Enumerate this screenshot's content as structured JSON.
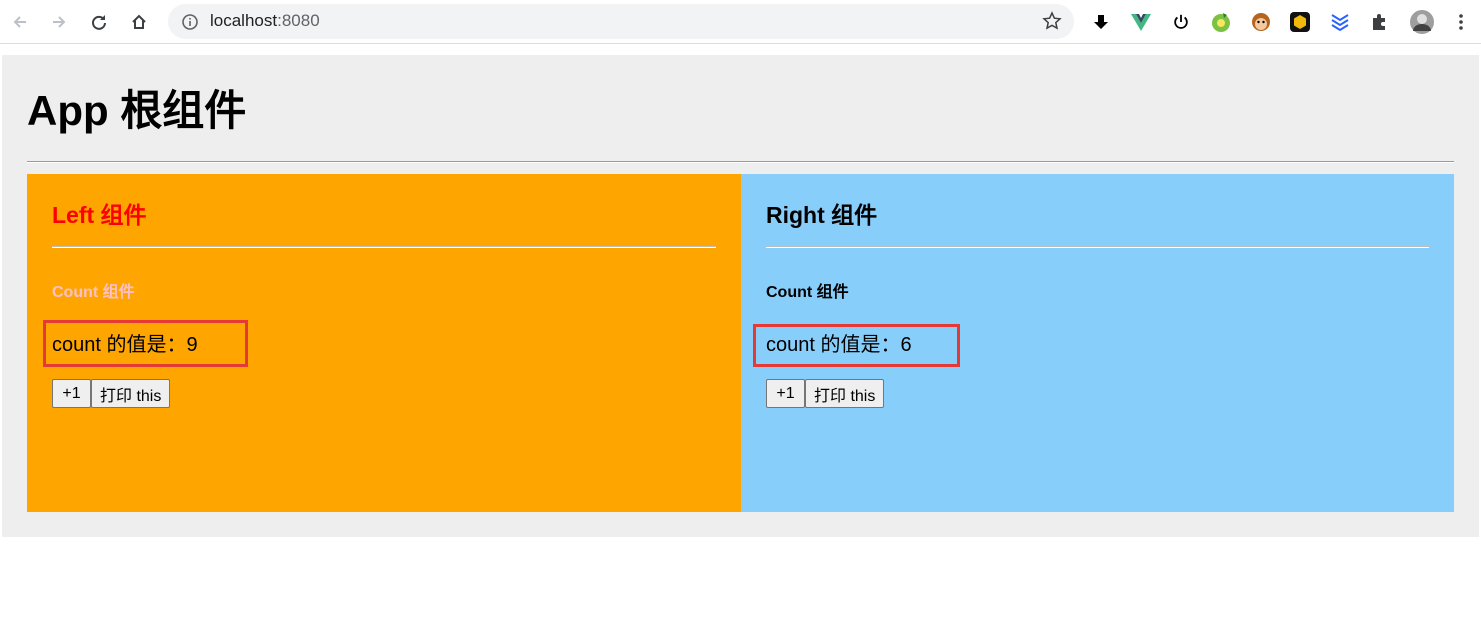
{
  "browser": {
    "url_host": "localhost",
    "url_port": ":8080"
  },
  "app": {
    "title": "App 根组件"
  },
  "left": {
    "title": "Left 组件",
    "count_title": "Count 组件",
    "count_text": "count 的值是：9",
    "increment_label": "+1",
    "print_label": "打印 this"
  },
  "right": {
    "title": "Right 组件",
    "count_title": "Count 组件",
    "count_text": "count 的值是：6",
    "increment_label": "+1",
    "print_label": "打印 this"
  },
  "colors": {
    "app_bg": "#eeeeee",
    "left_bg": "#ffa500",
    "right_bg": "#87cefa",
    "left_title": "#ff0000",
    "left_count_title": "#ffc0cb",
    "highlight_border": "#e53935"
  },
  "icons": [
    "back-icon",
    "forward-icon",
    "reload-icon",
    "home-icon",
    "info-icon",
    "star-icon",
    "download-icon",
    "vue-devtools-icon",
    "power-icon",
    "extension-green-icon",
    "extension-monkey-icon",
    "extension-cube-icon",
    "extension-layers-icon",
    "extensions-puzzle-icon",
    "profile-avatar-icon",
    "menu-dots-icon"
  ]
}
